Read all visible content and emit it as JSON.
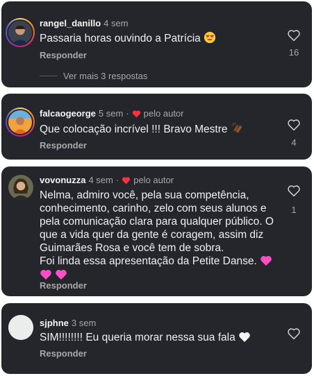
{
  "comments": [
    {
      "username": "rangel_danillo",
      "time": "4 sem",
      "text": "Passaria horas ouvindo a Patrícia",
      "reply_label": "Responder",
      "likes": "16",
      "more_replies": "Ver mais 3 respostas",
      "avatar_icon": "profile-photo"
    },
    {
      "username": "falcaogeorge",
      "time": "5 sem",
      "author_badge": "pelo autor",
      "text": "Que colocação incrível !!! Bravo Mestre",
      "reply_label": "Responder",
      "likes": "4",
      "avatar_icon": "profile-photo"
    },
    {
      "username": "vovonuzza",
      "time": "4 sem",
      "author_badge": "pelo autor",
      "text_lines": [
        "Nelma, admiro você, pela sua competência,",
        "conhecimento, carinho, zelo com seus alunos e",
        "pela comunicação clara para qualquer público. O",
        "que a vida quer da gente é coragem, assim diz",
        "Guimarães Rosa e você tem de sobra.",
        "Foi linda essa apresentação da Petite Danse."
      ],
      "reply_label": "Responder",
      "likes": "1",
      "avatar_icon": "profile-photo"
    },
    {
      "username": "sjphne",
      "time": "3 sem",
      "text": "SIM!!!!!!!! Eu queria morar nessa sua fala",
      "reply_label": "Responder",
      "avatar_icon": "default-avatar"
    }
  ],
  "colors": {
    "card_bg": "#25262c",
    "muted": "#a8a8a8",
    "author_heart": "#ff3040",
    "ring": "#d62976"
  }
}
